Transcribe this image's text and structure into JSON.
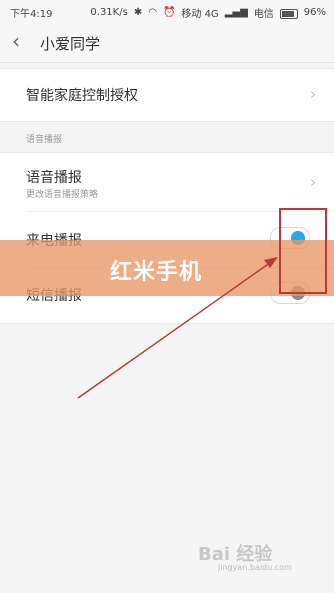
{
  "status_bar": {
    "time": "下午4:19",
    "network_speed": "0.31K/s",
    "carrier1": "移动 4G",
    "carrier2": "电信",
    "battery": "96%"
  },
  "header": {
    "title": "小爱同学"
  },
  "items": {
    "smart_home": {
      "label": "智能家庭控制授权"
    },
    "section_voice": {
      "label": "语音播报"
    },
    "voice": {
      "label": "语音播报",
      "sub": "更改语音播报策略"
    },
    "call": {
      "label": "来电播报",
      "toggle": true
    },
    "sms": {
      "label": "短信播报",
      "toggle": false
    }
  },
  "overlay": {
    "text": "红米手机"
  },
  "watermark": {
    "brand": "Bai 经验",
    "url": "jingyan.baidu.com"
  },
  "colors": {
    "accent": "#2aa7e8",
    "annotation": "#b83a3a",
    "band": "#e89664"
  }
}
